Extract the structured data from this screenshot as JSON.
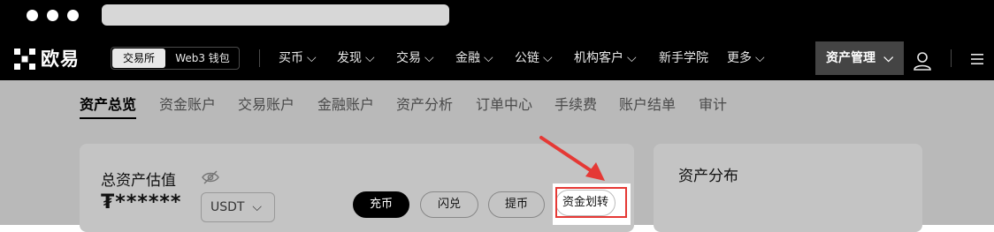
{
  "topnav": {
    "logo_text": "欧易",
    "mode_exchange": "交易所",
    "mode_web3": "Web3 钱包",
    "items": [
      {
        "label": "买币",
        "dropdown": true
      },
      {
        "label": "发现",
        "dropdown": true
      },
      {
        "label": "交易",
        "dropdown": true
      },
      {
        "label": "金融",
        "dropdown": true
      },
      {
        "label": "公链",
        "dropdown": true
      },
      {
        "label": "机构客户",
        "dropdown": true
      },
      {
        "label": "新手学院",
        "dropdown": false
      },
      {
        "label": "更多",
        "dropdown": true
      }
    ],
    "asset_management": "资产管理"
  },
  "subnav": {
    "items": [
      "资产总览",
      "资金账户",
      "交易账户",
      "金融账户",
      "资产分析",
      "订单中心",
      "手续费",
      "账户结单",
      "审计"
    ],
    "active": "资产总览"
  },
  "overview": {
    "title": "总资产估值",
    "masked_value": "₮******",
    "currency": "USDT",
    "buttons": {
      "deposit": "充币",
      "convert": "闪兑",
      "withdraw": "提币",
      "transfer": "资金划转"
    }
  },
  "distribution": {
    "title": "资产分布"
  },
  "colors": {
    "highlight": "#e53935",
    "overlay": "#b9b9b9"
  }
}
